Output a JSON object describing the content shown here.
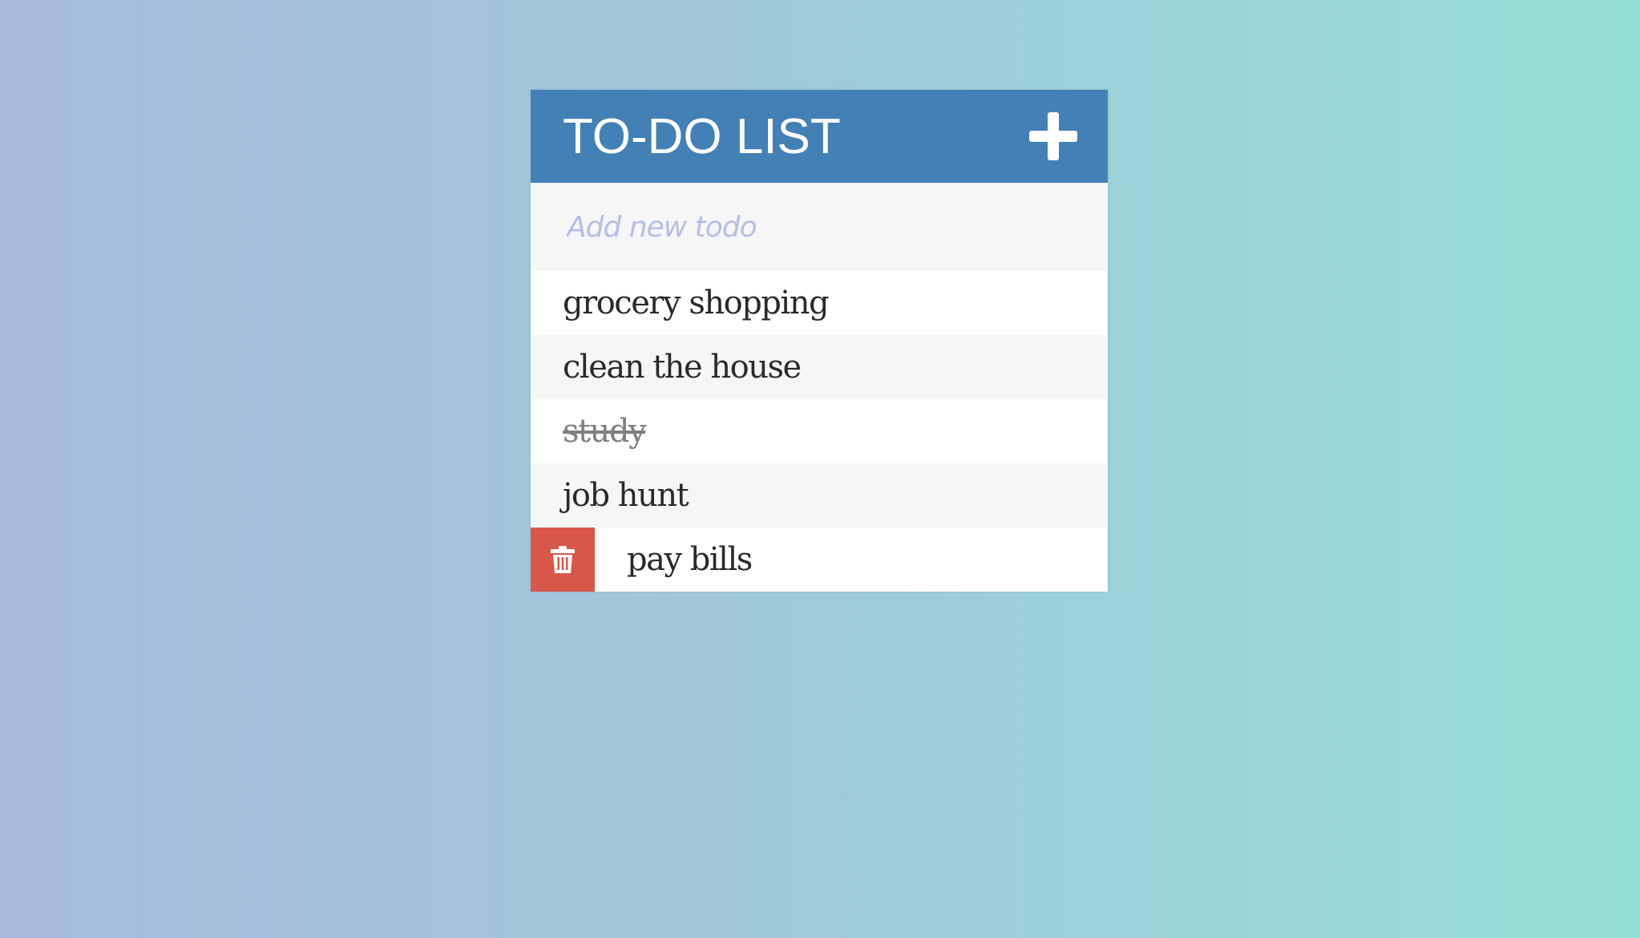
{
  "header": {
    "title": "TO-DO LIST",
    "add_icon": "plus-icon"
  },
  "new_todo": {
    "placeholder": "Add new todo",
    "value": ""
  },
  "todos": [
    {
      "text": "grocery shopping",
      "completed": false
    },
    {
      "text": "clean the house",
      "completed": false
    },
    {
      "text": "study",
      "completed": true
    },
    {
      "text": "job hunt",
      "completed": false
    },
    {
      "text": "pay bills",
      "completed": false,
      "delete_visible": true,
      "delete_icon": "trash-icon"
    }
  ],
  "colors": {
    "header_bg": "#4380b5",
    "delete_bg": "#d9574a",
    "placeholder": "#b7bee4",
    "row_alt": "#f6f6f6"
  }
}
